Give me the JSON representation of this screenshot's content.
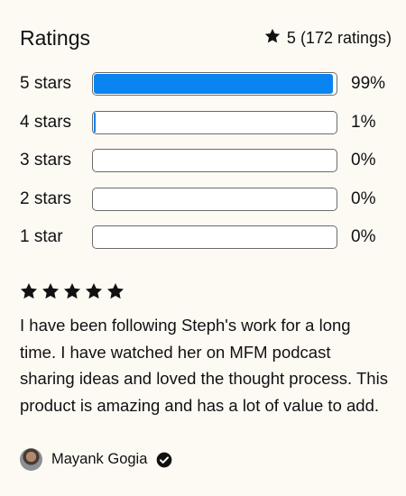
{
  "header": {
    "title": "Ratings",
    "average": "5",
    "count_text": "(172 ratings)"
  },
  "distribution": [
    {
      "label": "5 stars",
      "percent_text": "99%",
      "fraction": 0.99
    },
    {
      "label": "4 stars",
      "percent_text": "1%",
      "fraction": 0.01
    },
    {
      "label": "3 stars",
      "percent_text": "0%",
      "fraction": 0.0
    },
    {
      "label": "2 stars",
      "percent_text": "0%",
      "fraction": 0.0
    },
    {
      "label": "1 star",
      "percent_text": "0%",
      "fraction": 0.0
    }
  ],
  "review": {
    "stars": 5,
    "text": "I have been following Steph's work for a long time. I have watched her on MFM podcast sharing ideas and loved the thought process. This product is amazing and has a lot of value to add.",
    "reviewer_name": "Mayank Gogia",
    "verified": true
  },
  "colors": {
    "bar_fill": "#0a84f0",
    "background": "#fdfaf4"
  },
  "icons": {
    "summary": "star-icon",
    "review": "star-icon",
    "verified": "check-circle-icon"
  }
}
